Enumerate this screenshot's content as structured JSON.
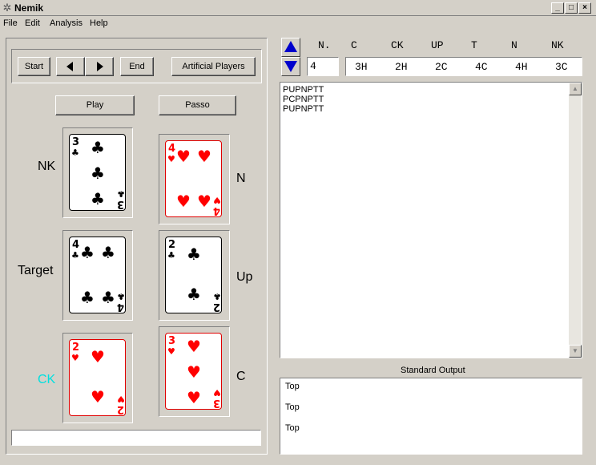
{
  "window": {
    "title": "Nemik"
  },
  "menu": {
    "items": [
      "File",
      "Edit",
      "Analysis",
      "Help"
    ]
  },
  "controls": {
    "start": "Start",
    "end": "End",
    "artificial_players": "Artificial Players",
    "play": "Play",
    "passo": "Passo"
  },
  "players": {
    "nk": "NK",
    "n": "N",
    "target": "Target",
    "up": "Up",
    "ck": "CK",
    "c": "C"
  },
  "cards": [
    {
      "player": "NK",
      "rank": "3",
      "suit": "clubs",
      "color": "black"
    },
    {
      "player": "N",
      "rank": "4",
      "suit": "hearts",
      "color": "red"
    },
    {
      "player": "Target",
      "rank": "4",
      "suit": "clubs",
      "color": "black"
    },
    {
      "player": "Up",
      "rank": "2",
      "suit": "clubs",
      "color": "black"
    },
    {
      "player": "CK",
      "rank": "2",
      "suit": "hearts",
      "color": "red"
    },
    {
      "player": "C",
      "rank": "3",
      "suit": "hearts",
      "color": "red"
    }
  ],
  "table": {
    "headers": [
      "N.",
      "C",
      "CK",
      "UP",
      "T",
      "N",
      "NK"
    ],
    "number": "4",
    "values": [
      "3H",
      "2H",
      "2C",
      "4C",
      "4H",
      "3C"
    ]
  },
  "moves": [
    "PUPNPTT",
    "PCPNPTT",
    "PUPNPTT"
  ],
  "standard_output": {
    "label": "Standard Output",
    "lines": [
      "Top",
      "Top",
      "Top"
    ]
  },
  "status": {
    "text": ""
  },
  "colors": {
    "ck_label": "#00e0e0",
    "red_suit": "#ff0000",
    "arrow": "#0000cc"
  }
}
